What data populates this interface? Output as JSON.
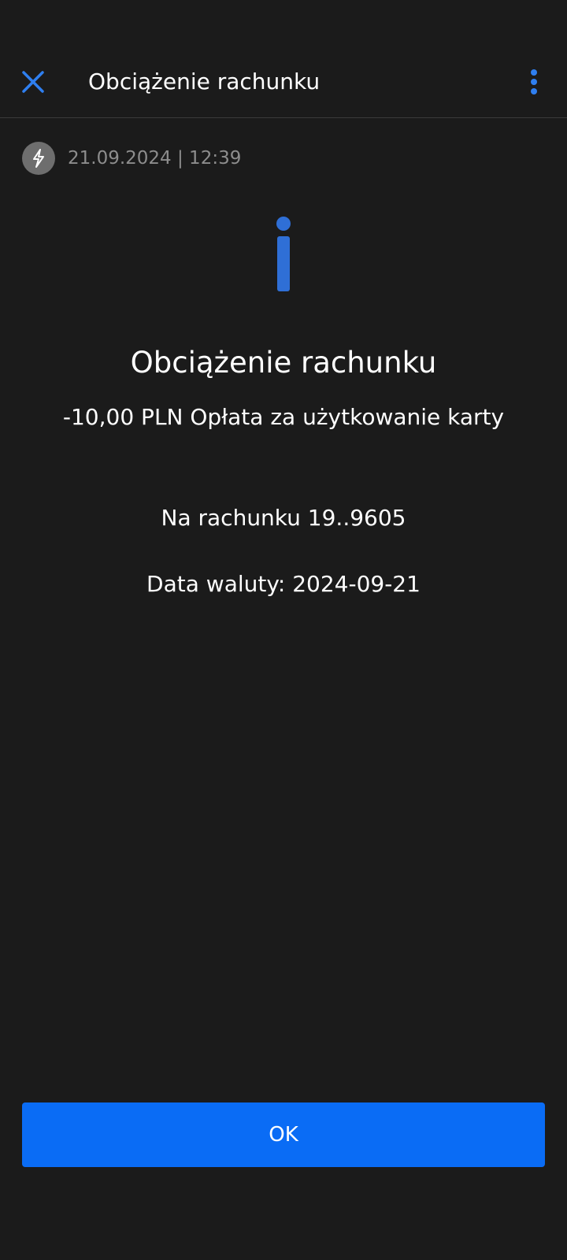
{
  "header": {
    "title": "Obciążenie rachunku",
    "close_icon": "close-icon",
    "more_icon": "more-vertical-icon"
  },
  "meta": {
    "icon": "lightning-icon",
    "datetime": "21.09.2024 | 12:39"
  },
  "message": {
    "icon": "info-icon",
    "heading": "Obciążenie rachunku",
    "subheading": "-10,00 PLN Opłata za użytkowanie karty",
    "account": "Na rachunku 19..9605",
    "value_date": "Data waluty: 2024-09-21"
  },
  "actions": {
    "ok_label": "OK"
  },
  "colors": {
    "background": "#1b1b1b",
    "accent": "#0a6cf5",
    "icon_blue": "#2f6fd6",
    "muted_text": "#8d8d8d"
  }
}
